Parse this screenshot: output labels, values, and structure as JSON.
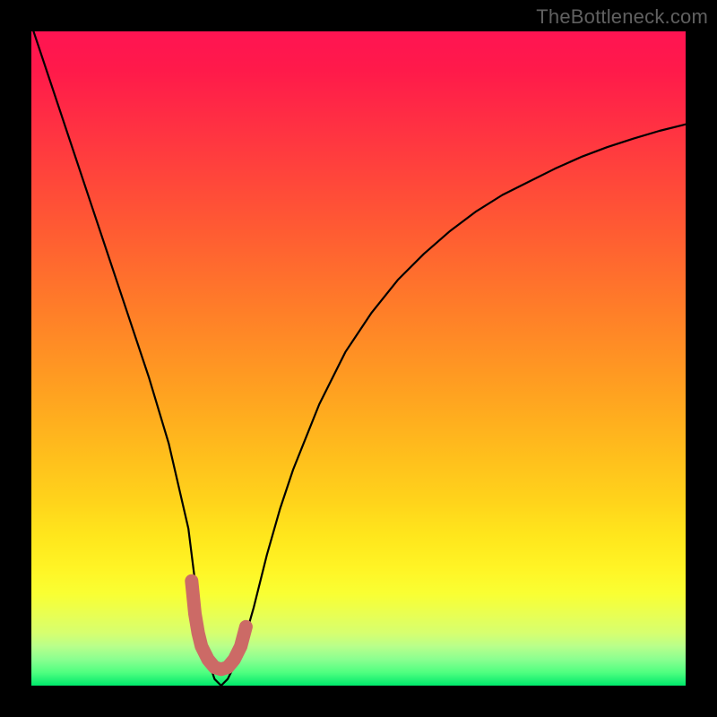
{
  "watermark": "TheBottleneck.com",
  "chart_data": {
    "type": "line",
    "title": "",
    "xlabel": "",
    "ylabel": "",
    "xlim": [
      0,
      100
    ],
    "ylim": [
      0,
      100
    ],
    "grid": false,
    "series": [
      {
        "name": "bottleneck-curve",
        "x": [
          0,
          3,
          6,
          9,
          12,
          15,
          18,
          21,
          24,
          25.5,
          27,
          28,
          29,
          30,
          32,
          34,
          36,
          38,
          40,
          44,
          48,
          52,
          56,
          60,
          64,
          68,
          72,
          76,
          80,
          84,
          88,
          92,
          96,
          100
        ],
        "values": [
          101,
          92,
          83,
          74,
          65,
          56,
          47,
          37,
          24,
          12,
          4,
          1,
          0,
          1,
          5,
          12,
          20,
          27,
          33,
          43,
          51,
          57,
          62,
          66,
          69.5,
          72.5,
          75,
          77,
          79,
          80.8,
          82.3,
          83.6,
          84.8,
          85.8
        ]
      }
    ],
    "highlight": {
      "name": "optimal-band",
      "color": "#cc6a66",
      "x": [
        24.5,
        25,
        25.5,
        26,
        27,
        28,
        29,
        30,
        31,
        32,
        32.8
      ],
      "values": [
        16,
        11,
        8,
        6,
        4,
        2.8,
        2.5,
        2.8,
        4,
        6,
        9
      ]
    },
    "colors": {
      "curve": "#000000",
      "highlight": "#cc6a66",
      "gradient_top": "#ff1452",
      "gradient_bottom": "#00e86b"
    }
  }
}
